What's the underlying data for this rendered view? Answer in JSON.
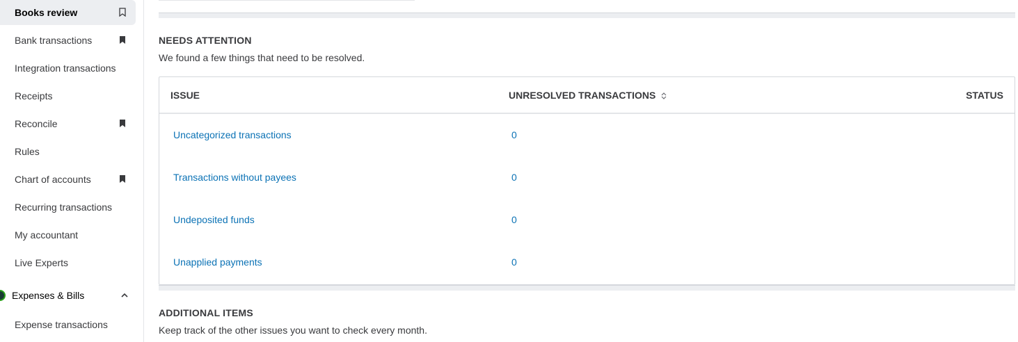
{
  "sidebar": {
    "items": [
      {
        "label": "Books review",
        "bookmark": "outline"
      },
      {
        "label": "Bank transactions",
        "bookmark": "filled"
      },
      {
        "label": "Integration transactions",
        "bookmark": "none"
      },
      {
        "label": "Receipts",
        "bookmark": "none"
      },
      {
        "label": "Reconcile",
        "bookmark": "filled"
      },
      {
        "label": "Rules",
        "bookmark": "none"
      },
      {
        "label": "Chart of accounts",
        "bookmark": "filled"
      },
      {
        "label": "Recurring transactions",
        "bookmark": "none"
      },
      {
        "label": "My accountant",
        "bookmark": "none"
      },
      {
        "label": "Live Experts",
        "bookmark": "none"
      }
    ],
    "section": {
      "label": "Expenses & Bills",
      "icon": "expenses-icon",
      "expanded": true
    },
    "sub_items": [
      {
        "label": "Expense transactions"
      }
    ]
  },
  "needs_attention": {
    "title": "NEEDS ATTENTION",
    "subtitle": "We found a few things that need to be resolved.",
    "columns": {
      "issue": "ISSUE",
      "unresolved": "UNRESOLVED TRANSACTIONS",
      "status": "STATUS"
    },
    "rows": [
      {
        "issue": "Uncategorized transactions",
        "count": "0"
      },
      {
        "issue": "Transactions without payees",
        "count": "0"
      },
      {
        "issue": "Undeposited funds",
        "count": "0"
      },
      {
        "issue": "Unapplied payments",
        "count": "0"
      }
    ]
  },
  "additional_items": {
    "title": "ADDITIONAL ITEMS",
    "subtitle": "Keep track of the other issues you want to check every month."
  },
  "colors": {
    "link": "#0b72b5",
    "active_bg": "#eceef1",
    "brand": "#2ca01c"
  }
}
